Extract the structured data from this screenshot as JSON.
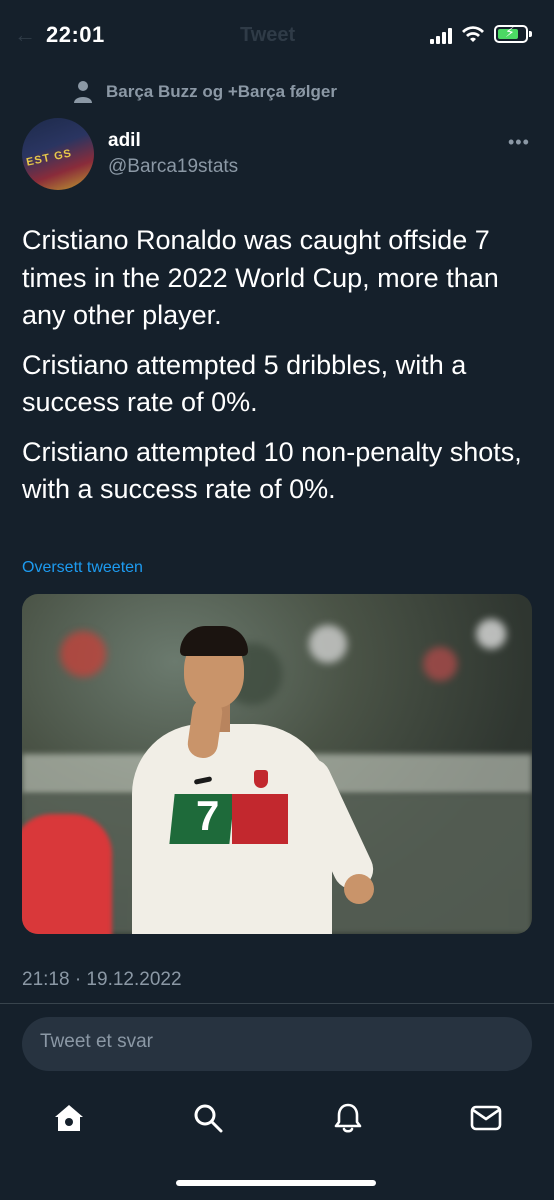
{
  "status_bar": {
    "time": "22:01"
  },
  "header": {
    "title": "Tweet",
    "back_icon": "arrow-left-icon"
  },
  "social_context": {
    "text": "Barça Buzz og +Barça følger",
    "icon": "person-icon"
  },
  "tweet": {
    "author_name": "adil",
    "author_handle": "@Barca19stats",
    "paragraphs": [
      "Cristiano Ronaldo was caught offside 7 times in the 2022 World Cup, more than any other player.",
      "Cristiano attempted 5 dribbles, with a success rate of 0%.",
      "Cristiano attempted 10 non-penalty shots, with a success rate of 0%."
    ],
    "translate_label": "Oversett tweeten",
    "shirt_number": "7",
    "timestamp": "21:18 · 19.12.2022"
  },
  "reply": {
    "placeholder": "Tweet et svar"
  },
  "nav": {
    "items": [
      "home-icon",
      "search-icon",
      "notifications-bell-icon",
      "messages-envelope-icon"
    ]
  },
  "colors": {
    "background": "#15202b",
    "secondary_text": "#8b98a5",
    "link": "#1d9bf0",
    "reply_box": "#273340"
  }
}
